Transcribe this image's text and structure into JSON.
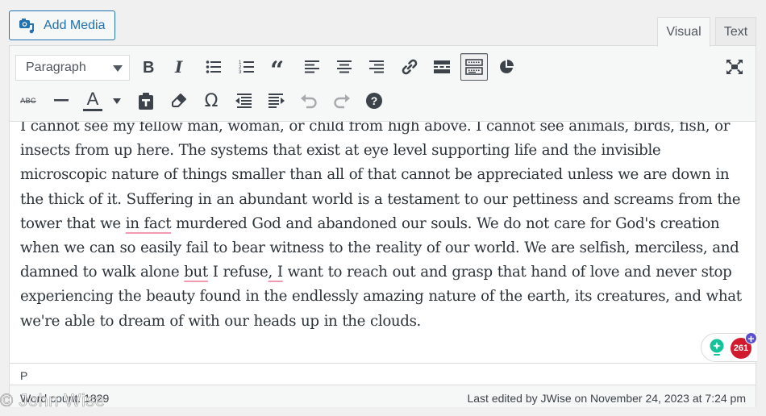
{
  "media": {
    "add_media_label": "Add Media"
  },
  "tabs": [
    {
      "label": "Visual",
      "active": true
    },
    {
      "label": "Text",
      "active": false
    }
  ],
  "toolbar": {
    "format_select": {
      "value": "Paragraph"
    },
    "row1": [
      {
        "name": "bold",
        "icon": "bold-icon"
      },
      {
        "name": "italic",
        "icon": "italic-icon"
      },
      {
        "name": "bulleted-list",
        "icon": "bulleted-list-icon"
      },
      {
        "name": "numbered-list",
        "icon": "numbered-list-icon"
      },
      {
        "name": "blockquote",
        "icon": "blockquote-icon"
      },
      {
        "name": "align-left",
        "icon": "align-left-icon"
      },
      {
        "name": "align-center",
        "icon": "align-center-icon"
      },
      {
        "name": "align-right",
        "icon": "align-right-icon"
      },
      {
        "name": "insert-link",
        "icon": "link-icon"
      },
      {
        "name": "read-more",
        "icon": "read-more-icon"
      },
      {
        "name": "toolbar-toggle",
        "icon": "keyboard-icon",
        "active": true
      },
      {
        "name": "chart",
        "icon": "pie-chart-icon"
      },
      {
        "name": "fullscreen",
        "icon": "fullscreen-icon"
      }
    ],
    "row2": [
      {
        "name": "strikethrough",
        "icon": "strikethrough-icon",
        "glyph": "ABC"
      },
      {
        "name": "horizontal-line",
        "icon": "horizontal-line-icon"
      },
      {
        "name": "text-color",
        "icon": "text-color-icon",
        "glyph": "A"
      },
      {
        "name": "text-color-dropdown",
        "icon": "caret-down-icon"
      },
      {
        "name": "paste-as-text",
        "icon": "paste-text-icon"
      },
      {
        "name": "clear-formatting",
        "icon": "eraser-icon"
      },
      {
        "name": "special-character",
        "icon": "omega-icon",
        "glyph": "Ω"
      },
      {
        "name": "outdent",
        "icon": "outdent-icon"
      },
      {
        "name": "indent",
        "icon": "indent-icon"
      },
      {
        "name": "undo",
        "icon": "undo-icon",
        "disabled": true
      },
      {
        "name": "redo",
        "icon": "redo-icon",
        "disabled": true
      },
      {
        "name": "keyboard-shortcuts",
        "icon": "help-icon",
        "glyph": "?"
      }
    ]
  },
  "content": {
    "segments": [
      "I cannot see my fellow man, woman, or child from high above. I cannot see animals, birds, fish, or insects from up here. The systems that exist at eye level supporting life and the invisible microscopic nature of things smaller than all of that cannot be appreciated unless we are down in the thick of it. Suffering in an abundant world is a testament to our pettiness and screams from the tower that we ",
      "in fact",
      " murdered God and abandoned our souls. We do not care for God's creation when we can so easily fail to bear witness to the reality of our world. We are selfish, merciless, and damned to walk alone ",
      "but",
      " I refuse",
      ", I",
      " want to reach out and grasp that hand of love and never stop experiencing the beauty found in the endlessly amazing nature of the earth, its creatures, and what we're able to dream of with our heads up in the clouds."
    ]
  },
  "grammarly": {
    "issue_count": "261",
    "plus_glyph": "+"
  },
  "path": "P",
  "status": {
    "word_count": "Word count: 1829",
    "last_edited": "Last edited by JWise on November 24, 2023 at 7:24 pm"
  },
  "watermark": "© John Wise",
  "colors": {
    "accent": "#2271b1",
    "spell_underline": "#f29ab0",
    "grammarly_red": "#d21a2f",
    "grammarly_green": "#15c39a"
  }
}
